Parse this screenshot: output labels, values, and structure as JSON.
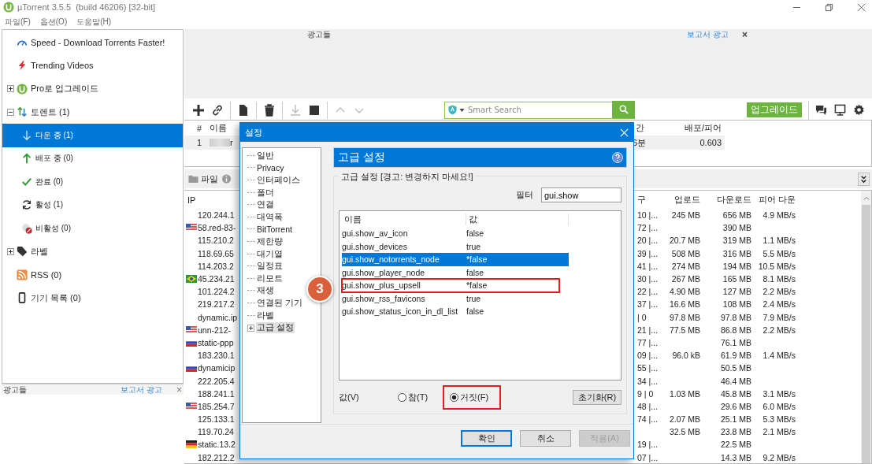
{
  "window": {
    "title": "µTorrent 3.5.5  (build 46206) [32-bit]"
  },
  "menu": [
    "파일(F)",
    "옵션(O)",
    "도움말(H)"
  ],
  "sidebar": {
    "items": [
      {
        "label": "Speed - Download Torrents Faster!",
        "kind": "speed",
        "selected": false
      },
      {
        "label": "Trending Videos",
        "kind": "bolt",
        "selected": false
      },
      {
        "label": "Pro로 업그레이드",
        "kind": "logo",
        "selected": false,
        "expanded": false
      },
      {
        "label": "토렌트 (1)",
        "kind": "updown",
        "selected": false,
        "expanded": true,
        "children": [
          {
            "label": "다운 중 (1)",
            "kind": "down",
            "selected": true
          },
          {
            "label": "배포 중 (0)",
            "kind": "up",
            "selected": false
          },
          {
            "label": "완료 (0)",
            "kind": "check",
            "selected": false
          },
          {
            "label": "활성 (1)",
            "kind": "refresh",
            "selected": false
          },
          {
            "label": "비활성 (0)",
            "kind": "inactive",
            "selected": false
          }
        ]
      },
      {
        "label": "라벨",
        "kind": "tag",
        "selected": false,
        "expanded": false
      },
      {
        "label": "RSS (0)",
        "kind": "rss",
        "selected": false
      },
      {
        "label": "기기 목록 (0)",
        "kind": "device",
        "selected": false
      }
    ]
  },
  "sidebar_ad": {
    "label": "광고들",
    "link": "보고서 광고",
    "close": "×"
  },
  "top_ad": {
    "label": "광고들",
    "link": "보고서 광고",
    "close": "×"
  },
  "toolbar": {
    "groups": [
      [
        {
          "kind": "plus",
          "disabled": false
        },
        {
          "kind": "link",
          "disabled": false
        }
      ],
      [
        {
          "kind": "file",
          "disabled": false
        }
      ],
      [
        {
          "kind": "trash",
          "disabled": false
        }
      ],
      [
        {
          "kind": "download",
          "disabled": true
        },
        {
          "kind": "stop",
          "disabled": false
        }
      ],
      [
        {
          "kind": "up",
          "disabled": true
        },
        {
          "kind": "down",
          "disabled": true
        }
      ]
    ],
    "search": {
      "placeholder": "Smart Search"
    },
    "upgrade": "업그레이드"
  },
  "torrents": {
    "columns": [
      "#",
      "이름",
      "간",
      "배포/피어"
    ],
    "rows": [
      {
        "cells": [
          "1",
          "r",
          "6분",
          "0.603"
        ]
      }
    ]
  },
  "detail_tabs": [
    {
      "label": "파일",
      "kind": "folder"
    },
    {
      "kind": "info"
    }
  ],
  "peers": {
    "columns": [
      "IP",
      "구",
      "업로드",
      "다운로드",
      "피어 다운"
    ],
    "rows": [
      {
        "ip": "120.244.1",
        "client": "10 |...",
        "upload": "245 MB",
        "download": "656 MB",
        "peer_down": "4.9 MB/s"
      },
      {
        "ip": "58.red-83-",
        "kind": "us",
        "client": "72 |...",
        "download": "390 MB"
      },
      {
        "ip": "115.210.2",
        "client": "20 |...",
        "upload": "20.7 MB",
        "download": "319 MB",
        "peer_down": "1.1 MB/s"
      },
      {
        "ip": "118.69.65",
        "client": "39 |...",
        "upload": "508 MB",
        "download": "316 MB",
        "peer_down": "5.5 MB/s"
      },
      {
        "ip": "114.203.2",
        "client": "41 |...",
        "upload": "274 MB",
        "download": "194 MB",
        "peer_down": "10.5 MB/s"
      },
      {
        "ip": "45.234.21",
        "kind": "br",
        "client": "30 |...",
        "upload": "267 MB",
        "download": "165 MB",
        "peer_down": "8.1 MB/s"
      },
      {
        "ip": "101.224.2",
        "client": "22 |...",
        "upload": "4.90 MB",
        "download": "127 MB",
        "peer_down": "2.2 MB/s"
      },
      {
        "ip": "219.217.2",
        "client": "37 |...",
        "upload": "16.6 MB",
        "download": "108 MB",
        "peer_down": "2.4 MB/s"
      },
      {
        "ip": "dynamic.ip",
        "client": "| 0",
        "upload": "97.8 MB",
        "download": "97.8 MB",
        "peer_down": "7.9 MB/s"
      },
      {
        "ip": "unn-212-",
        "kind": "us",
        "client": "21 |...",
        "upload": "77.5 MB",
        "download": "86.8 MB",
        "peer_down": "2.2 MB/s"
      },
      {
        "ip": "static-ppp",
        "kind": "ru",
        "client": "77 |...",
        "download": "76.1 MB"
      },
      {
        "ip": "183.230.1",
        "client": "09 |...",
        "upload": "96.0 kB",
        "download": "61.9 MB",
        "peer_down": "1.4 MB/s"
      },
      {
        "ip": "dynamicip",
        "kind": "ru",
        "client": "55 |...",
        "download": "50.5 MB"
      },
      {
        "ip": "222.205.4",
        "client": "34 |...",
        "download": "46.4 MB"
      },
      {
        "ip": "188.241.1",
        "client": "9 | 0",
        "upload": "1.03 MB",
        "download": "45.8 MB",
        "peer_down": "3.1 MB/s"
      },
      {
        "ip": "185.254.7",
        "kind": "us",
        "client": "48 |...",
        "download": "29.6 MB",
        "peer_down": "6.0 MB/s"
      },
      {
        "ip": "125.133.1",
        "client": "74 |...",
        "upload": "2.07 MB",
        "download": "25.1 MB",
        "peer_down": "5.3 MB/s"
      },
      {
        "ip": "119.70.24",
        "upload": "32.5 MB",
        "download": "23.8 MB",
        "peer_down": "2.1 MB/s"
      },
      {
        "ip": "static.13.2",
        "kind": "de",
        "client": "19 |...",
        "download": "22.5 MB"
      },
      {
        "ip": "182.212.2",
        "client": "07 |...",
        "download": "14.3 MB",
        "peer_down": "9.2 MB/s"
      }
    ]
  },
  "dialog": {
    "title": "설정",
    "tree": [
      {
        "label": "일반",
        "selected": false
      },
      {
        "label": "Privacy",
        "selected": false
      },
      {
        "label": "인터페이스",
        "selected": false
      },
      {
        "label": "폴더",
        "selected": false
      },
      {
        "label": "연결",
        "selected": false
      },
      {
        "label": "대역폭",
        "selected": false
      },
      {
        "label": "BitTorrent",
        "selected": false
      },
      {
        "label": "제한량",
        "selected": false
      },
      {
        "label": "대기열",
        "selected": false
      },
      {
        "label": "일정표",
        "selected": false
      },
      {
        "label": "리모트",
        "selected": false
      },
      {
        "label": "재생",
        "selected": false
      },
      {
        "label": "연결된 기기",
        "selected": false
      },
      {
        "label": "라벨",
        "selected": false
      },
      {
        "label": "고급 설정",
        "selected": true,
        "expanded": false
      }
    ],
    "header": "고급 설정",
    "group_label": "고급 설정 [경고: 변경하지 마세요!]",
    "filter": {
      "label": "필터",
      "value": "gui.show"
    },
    "columns": [
      "이름",
      "값"
    ],
    "rows": [
      {
        "name": "gui.show_av_icon",
        "value": "false",
        "selected": false,
        "highlighted": false
      },
      {
        "name": "gui.show_devices",
        "value": "true",
        "selected": false,
        "highlighted": false
      },
      {
        "name": "gui.show_notorrents_node",
        "value": "*false",
        "selected": true,
        "highlighted": false
      },
      {
        "name": "gui.show_player_node",
        "value": "false",
        "selected": false,
        "highlighted": false
      },
      {
        "name": "gui.show_plus_upsell",
        "value": "*false",
        "selected": false,
        "highlighted": true
      },
      {
        "name": "gui.show_rss_favicons",
        "value": "true",
        "selected": false,
        "highlighted": false
      },
      {
        "name": "gui.show_status_icon_in_dl_list",
        "value": "false",
        "selected": false,
        "highlighted": false
      }
    ],
    "value_label": "값(V)",
    "options": [
      {
        "label": "참(T)",
        "selected": false,
        "highlighted": false
      },
      {
        "label": "거짓(F)",
        "selected": true,
        "highlighted": true
      }
    ],
    "reset": "초기화(R)",
    "buttons": [
      {
        "label": "확인",
        "kind": "default",
        "disabled": false
      },
      {
        "label": "취소",
        "kind": "normal",
        "disabled": false
      },
      {
        "label": "적용(A)",
        "kind": "normal",
        "disabled": true
      }
    ]
  },
  "step_badge": "3"
}
